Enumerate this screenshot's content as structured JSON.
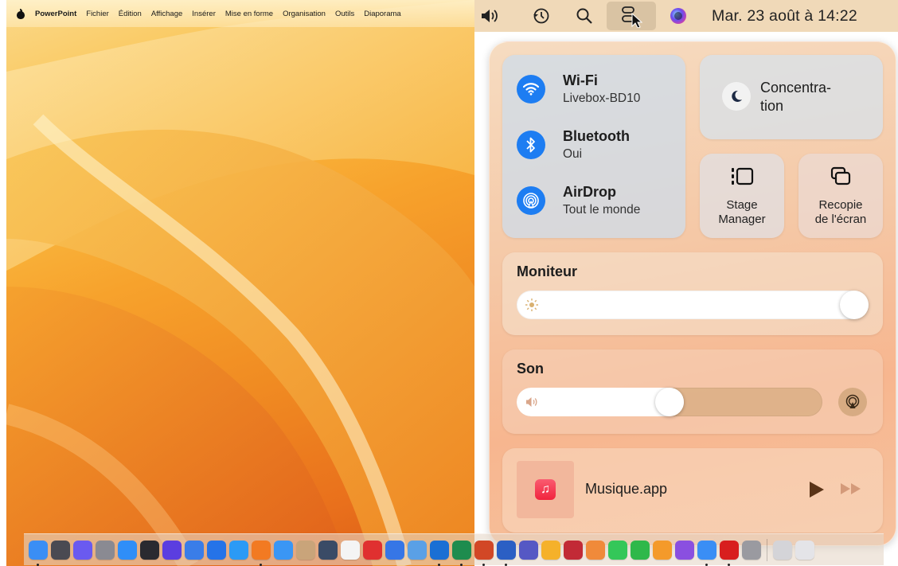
{
  "menubar_left": {
    "app_name": "PowerPoint",
    "menus": [
      "Fichier",
      "Édition",
      "Affichage",
      "Insérer",
      "Mise en forme",
      "Organisation",
      "Outils",
      "Diaporama"
    ]
  },
  "menubar_right": {
    "icons": [
      "volume-icon",
      "time-machine-icon",
      "spotlight-search-icon",
      "control-center-icon",
      "siri-icon"
    ],
    "clock": "Mar. 23 août à 14:22"
  },
  "control_center": {
    "wifi": {
      "title": "Wi-Fi",
      "subtitle": "Livebox-BD10",
      "enabled": true
    },
    "bluetooth": {
      "title": "Bluetooth",
      "subtitle": "Oui",
      "enabled": true
    },
    "airdrop": {
      "title": "AirDrop",
      "subtitle": "Tout le monde",
      "enabled": true
    },
    "focus": {
      "label": "Concentra-tion",
      "line1": "Concentra-",
      "line2": "tion"
    },
    "stage_manager": {
      "line1": "Stage",
      "line2": "Manager"
    },
    "screen_mirroring": {
      "line1": "Recopie",
      "line2": "de l'écran"
    },
    "display": {
      "title": "Moniteur",
      "brightness": 1.0
    },
    "sound": {
      "title": "Son",
      "volume": 0.5
    },
    "now_playing": {
      "app": "Musique.app"
    }
  },
  "colors": {
    "accent_blue": "#1d7df2",
    "menubar_bg": "#f0d9b8",
    "music_red": "#f1243d"
  },
  "dock": {
    "apps": [
      {
        "name": "finder-icon",
        "color": "#3a8ef5",
        "running": true
      },
      {
        "name": "screenshot-icon",
        "color": "#4a4a52",
        "running": false
      },
      {
        "name": "launchpad-icon",
        "color": "#6a5af0",
        "running": false
      },
      {
        "name": "system-settings-icon",
        "color": "#8a8a92",
        "running": false
      },
      {
        "name": "app-store-icon",
        "color": "#2f8ef8",
        "running": false
      },
      {
        "name": "activity-monitor-icon",
        "color": "#2a2a30",
        "running": false
      },
      {
        "name": "imovie-icon",
        "color": "#5b3ee0",
        "running": false
      },
      {
        "name": "chrome-like-icon",
        "color": "#3a7de8",
        "running": false
      },
      {
        "name": "teamviewer-icon",
        "color": "#2573e8",
        "running": false
      },
      {
        "name": "safari-icon",
        "color": "#2b9af5",
        "running": false
      },
      {
        "name": "firefox-icon",
        "color": "#f27a22",
        "running": true
      },
      {
        "name": "mail-icon",
        "color": "#3a96f5",
        "running": false
      },
      {
        "name": "contacts-icon",
        "color": "#c9a47a",
        "running": false
      },
      {
        "name": "quicktime-icon",
        "color": "#3a4b66",
        "running": false
      },
      {
        "name": "calendar-icon",
        "color": "#f4f4f4",
        "running": false
      },
      {
        "name": "toolbox-icon",
        "color": "#e03030",
        "running": false
      },
      {
        "name": "keynote-like-icon",
        "color": "#3676e6",
        "running": false
      },
      {
        "name": "preview-icon",
        "color": "#5aa0e6",
        "running": false
      },
      {
        "name": "outlook-icon",
        "color": "#1a6fd4",
        "running": true
      },
      {
        "name": "excel-icon",
        "color": "#1e8c4e",
        "running": true
      },
      {
        "name": "powerpoint-icon",
        "color": "#d24726",
        "running": true
      },
      {
        "name": "word-icon",
        "color": "#2b5fc4",
        "running": true
      },
      {
        "name": "teams-icon",
        "color": "#5558c4",
        "running": false
      },
      {
        "name": "pencil-icon",
        "color": "#f5b12a",
        "running": false
      },
      {
        "name": "photo-booth-icon",
        "color": "#c22a36",
        "running": false
      },
      {
        "name": "photos-icon",
        "color": "#f08a3a",
        "running": false
      },
      {
        "name": "messages-icon",
        "color": "#34c759",
        "running": false
      },
      {
        "name": "facetime-icon",
        "color": "#2fb84a",
        "running": false
      },
      {
        "name": "books-icon",
        "color": "#f49a2a",
        "running": false
      },
      {
        "name": "podcast-icon",
        "color": "#8a4fe0",
        "running": false
      },
      {
        "name": "icloud-icon",
        "color": "#3a8ef5",
        "running": true
      },
      {
        "name": "acrobat-icon",
        "color": "#d81e1e",
        "running": true
      },
      {
        "name": "apple-icon",
        "color": "#9a9aa0",
        "running": false
      }
    ],
    "trailing": [
      {
        "name": "downloads-stack-icon",
        "color": "#d4d4d8"
      },
      {
        "name": "trash-icon",
        "color": "#e4e4e8"
      }
    ]
  }
}
